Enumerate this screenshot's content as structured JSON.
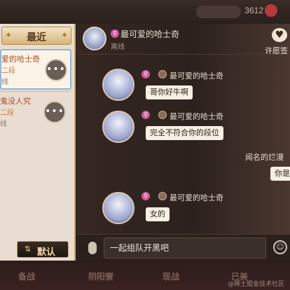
{
  "topbar": {
    "coins": "3612"
  },
  "left_panel": {
    "recent_tab": "最近",
    "contacts": [
      {
        "name": "爱的哈士奇",
        "rank": "二段",
        "status": "线"
      },
      {
        "name": "鬼没人究",
        "rank": "二段",
        "status": "线"
      }
    ],
    "sort_button": "默认"
  },
  "chat": {
    "header": {
      "name": "最可爱的哈士奇",
      "status": "离线",
      "wish_label": "许愿签"
    },
    "messages": [
      {
        "sender": "最可爱的哈士奇",
        "text": "哥你好牛啊"
      },
      {
        "sender": "最可爱的哈士奇",
        "text": "完全不符合你的段位"
      },
      {
        "sender": "最可爱的哈士奇",
        "text": "女的"
      }
    ],
    "side_text": "闻名的烂漫",
    "side_bubble": "你是",
    "input_value": "一起组队开黑吧"
  },
  "bottom_nav": [
    "备战",
    "阴阳寮",
    "现战",
    "已美"
  ],
  "watermark": "@稀土掘金技术社区",
  "colors": {
    "accent_gold": "#c9a66b",
    "name_red": "#b2492e",
    "badge_pink": "#d05a9a"
  }
}
